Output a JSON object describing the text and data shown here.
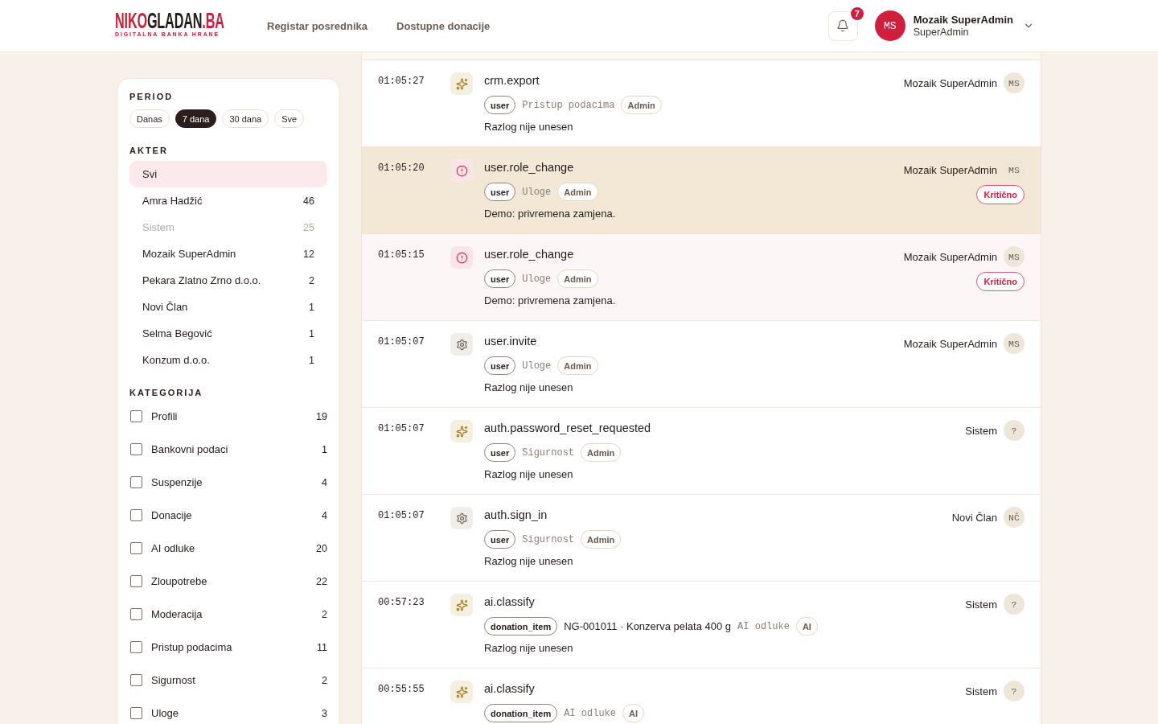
{
  "header": {
    "logo": {
      "wordmark": [
        {
          "text": "NIKO",
          "accent": true
        },
        {
          "text": "GLADAN",
          "accent": false
        },
        {
          "text": ".BA",
          "accent": true
        }
      ],
      "tagline": "DIGITALNA BANKA HRANE"
    },
    "nav": [
      {
        "label": "Registar posrednika"
      },
      {
        "label": "Dostupne donacije"
      }
    ],
    "notifications": {
      "count": "7"
    },
    "user": {
      "initials": "MS",
      "name": "Mozaik SuperAdmin",
      "role": "SuperAdmin"
    }
  },
  "filters": {
    "period": {
      "title": "PERIOD",
      "options": [
        {
          "label": "Danas",
          "selected": false
        },
        {
          "label": "7 dana",
          "selected": true
        },
        {
          "label": "30 dana",
          "selected": false
        },
        {
          "label": "Sve",
          "selected": false
        }
      ]
    },
    "actor": {
      "title": "AKTER",
      "items": [
        {
          "name": "Svi",
          "selected": true,
          "disabled": false
        },
        {
          "name": "Amra Hadžić",
          "count": "46",
          "selected": false,
          "disabled": false
        },
        {
          "name": "Sistem",
          "count": "25",
          "selected": false,
          "disabled": true
        },
        {
          "name": "Mozaik SuperAdmin",
          "count": "12",
          "selected": false,
          "disabled": false
        },
        {
          "name": "Pekara Zlatno Zrno d.o.o.",
          "count": "2",
          "selected": false,
          "disabled": false
        },
        {
          "name": "Novi Član",
          "count": "1",
          "selected": false,
          "disabled": false
        },
        {
          "name": "Selma Begović",
          "count": "1",
          "selected": false,
          "disabled": false
        },
        {
          "name": "Konzum d.o.o.",
          "count": "1",
          "selected": false,
          "disabled": false
        }
      ]
    },
    "category": {
      "title": "KATEGORIJA",
      "items": [
        {
          "label": "Profili",
          "count": "19",
          "checked": false
        },
        {
          "label": "Bankovni podaci",
          "count": "1",
          "checked": false
        },
        {
          "label": "Suspenzije",
          "count": "4",
          "checked": false
        },
        {
          "label": "Donacije",
          "count": "4",
          "checked": false
        },
        {
          "label": "AI odluke",
          "count": "20",
          "checked": false
        },
        {
          "label": "Zloupotrebe",
          "count": "22",
          "checked": false
        },
        {
          "label": "Moderacija",
          "count": "2",
          "checked": false
        },
        {
          "label": "Pristup podacima",
          "count": "11",
          "checked": false
        },
        {
          "label": "Sigurnost",
          "count": "2",
          "checked": false
        },
        {
          "label": "Uloge",
          "count": "3",
          "checked": false
        }
      ]
    }
  },
  "log": {
    "rows": [
      {
        "time": "01:05:27",
        "kind": "ai",
        "event": "crm.export",
        "tags": [
          {
            "kind": "entity",
            "text": "user"
          },
          {
            "kind": "category",
            "text": "Pristup podacima"
          },
          {
            "kind": "role",
            "text": "Admin"
          }
        ],
        "reason": "Razlog nije unesen",
        "actor": "Mozaik SuperAdmin",
        "initials": "MS",
        "selected": false
      },
      {
        "time": "01:05:20",
        "kind": "critical",
        "event": "user.role_change",
        "tags": [
          {
            "kind": "entity",
            "text": "user"
          },
          {
            "kind": "category",
            "text": "Uloge"
          },
          {
            "kind": "role",
            "text": "Admin"
          }
        ],
        "reason": "Demo: privremena zamjena.",
        "actor": "Mozaik SuperAdmin",
        "initials": "MS",
        "badge": "Kritično",
        "selected": true
      },
      {
        "time": "01:05:15",
        "kind": "critical",
        "event": "user.role_change",
        "tags": [
          {
            "kind": "entity",
            "text": "user"
          },
          {
            "kind": "category",
            "text": "Uloge"
          },
          {
            "kind": "role",
            "text": "Admin"
          }
        ],
        "reason": "Demo: privremena zamjena.",
        "actor": "Mozaik SuperAdmin",
        "initials": "MS",
        "badge": "Kritično",
        "selected": false
      },
      {
        "time": "01:05:07",
        "kind": "system",
        "event": "user.invite",
        "tags": [
          {
            "kind": "entity",
            "text": "user"
          },
          {
            "kind": "category",
            "text": "Uloge"
          },
          {
            "kind": "role",
            "text": "Admin"
          }
        ],
        "reason": "Razlog nije unesen",
        "actor": "Mozaik SuperAdmin",
        "initials": "MS",
        "selected": false
      },
      {
        "time": "01:05:07",
        "kind": "ai",
        "event": "auth.password_reset_requested",
        "tags": [
          {
            "kind": "entity",
            "text": "user"
          },
          {
            "kind": "category",
            "text": "Sigurnost"
          },
          {
            "kind": "role",
            "text": "Admin"
          }
        ],
        "reason": "Razlog nije unesen",
        "actor": "Sistem",
        "initials": "?",
        "selected": false
      },
      {
        "time": "01:05:07",
        "kind": "system",
        "event": "auth.sign_in",
        "tags": [
          {
            "kind": "entity",
            "text": "user"
          },
          {
            "kind": "category",
            "text": "Sigurnost"
          },
          {
            "kind": "role",
            "text": "Admin"
          }
        ],
        "reason": "Razlog nije unesen",
        "actor": "Novi Član",
        "initials": "NČ",
        "selected": false
      },
      {
        "time": "00:57:23",
        "kind": "ai",
        "event": "ai.classify",
        "tags": [
          {
            "kind": "entity",
            "text": "donation_item"
          },
          {
            "kind": "reference",
            "text": "NG-001011 · Konzerva pelata 400 g"
          },
          {
            "kind": "category",
            "text": "AI odluke"
          },
          {
            "kind": "role",
            "text": "AI"
          }
        ],
        "reason": "Razlog nije unesen",
        "actor": "Sistem",
        "initials": "?",
        "selected": false
      },
      {
        "time": "00:55:55",
        "kind": "ai",
        "event": "ai.classify",
        "tags": [
          {
            "kind": "entity",
            "text": "donation_item"
          },
          {
            "kind": "category",
            "text": "AI odluke"
          },
          {
            "kind": "role",
            "text": "AI"
          }
        ],
        "actor": "Sistem",
        "initials": "?",
        "selected": false
      }
    ]
  }
}
